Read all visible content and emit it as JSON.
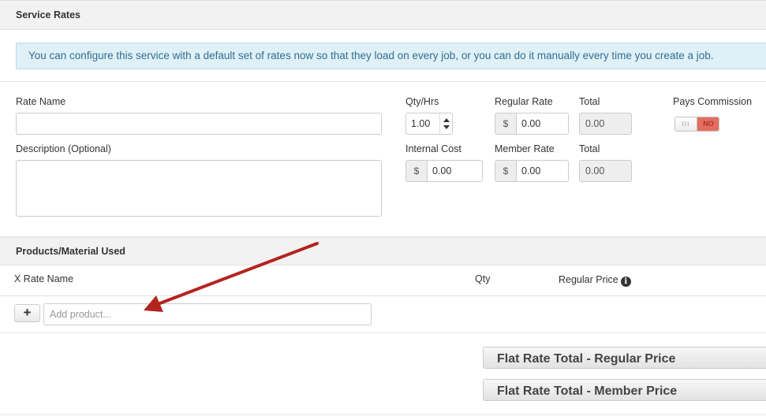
{
  "service_rates": {
    "title": "Service Rates",
    "info_message": "You can configure this service with a default set of rates now so that they load on every job, or you can do it manually every time you create a job."
  },
  "rate_form": {
    "rate_name_label": "Rate Name",
    "rate_name_value": "",
    "description_label": "Description (Optional)",
    "description_value": "",
    "qty_hrs_label": "Qty/Hrs",
    "qty_hrs_value": "1.00",
    "regular_rate_label": "Regular Rate",
    "regular_rate_value": "0.00",
    "regular_total_label": "Total",
    "regular_total_value": "0.00",
    "pays_commission_label": "Pays Commission",
    "pays_commission_handle": "III",
    "pays_commission_state": "NO",
    "internal_cost_label": "Internal Cost",
    "internal_cost_value": "0.00",
    "member_rate_label": "Member Rate",
    "member_rate_value": "0.00",
    "member_total_label": "Total",
    "member_total_value": "0.00",
    "currency_symbol": "$"
  },
  "products": {
    "title": "Products/Material Used",
    "columns": {
      "rate_name": "X Rate Name",
      "qty": "Qty",
      "regular_price": "Regular Price"
    },
    "add_button_label": "+",
    "add_product_placeholder": "Add product..."
  },
  "totals": {
    "flat_rate_regular": "Flat Rate Total - Regular Price",
    "flat_rate_member": "Flat Rate Total - Member Price"
  },
  "colors": {
    "info_bg": "#dff0f7",
    "info_text": "#31708f",
    "toggle_off": "#e36d5e",
    "annotation_arrow": "#b3241e"
  }
}
